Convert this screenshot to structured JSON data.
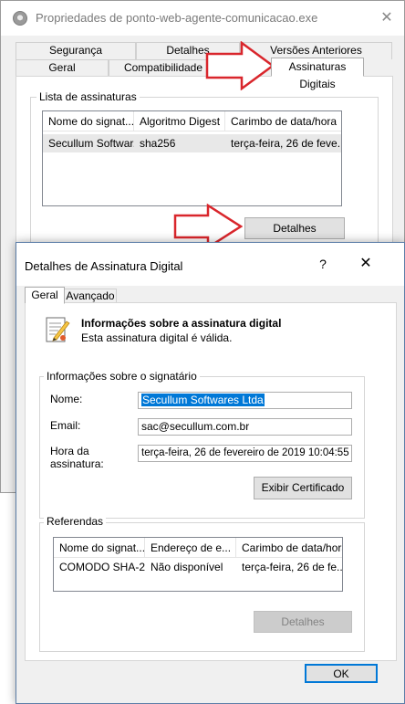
{
  "back_window": {
    "title": "Propriedades de ponto-web-agente-comunicacao.exe",
    "tabs_row1": [
      "Segurança",
      "Detalhes",
      "Versões Anteriores"
    ],
    "tabs_row2": [
      "Geral",
      "Compatibilidade",
      "Assinaturas Digitais"
    ],
    "group_label": "Lista de assinaturas",
    "list_headers": [
      "Nome do signat...",
      "Algoritmo Digest",
      "Carimbo de data/hora"
    ],
    "list_row": [
      "Secullum Softwar...",
      "sha256",
      "terça-feira, 26 de feve..."
    ],
    "details_button": "Detalhes"
  },
  "dialog": {
    "title": "Detalhes de Assinatura Digital",
    "help": "?",
    "tabs": [
      "Geral",
      "Avançado"
    ],
    "info_heading": "Informações sobre a assinatura digital",
    "info_status": "Esta assinatura digital é válida.",
    "signer_group_label": "Informações sobre o signatário",
    "name_label": "Nome:",
    "name_value": "Secullum Softwares Ltda",
    "email_label": "Email:",
    "email_value": "sac@secullum.com.br",
    "time_label_1": "Hora da",
    "time_label_2": "assinatura:",
    "time_value": "terça-feira, 26 de fevereiro de 2019 10:04:55",
    "view_cert_button": "Exibir Certificado",
    "refs_group_label": "Referendas",
    "refs_headers": [
      "Nome do signat...",
      "Endereço de e...",
      "Carimbo de data/hora"
    ],
    "refs_row": [
      "COMODO SHA-2...",
      "Não disponível",
      "terça-feira, 26 de fe..."
    ],
    "refs_details_button": "Detalhes",
    "ok_button": "OK"
  },
  "colors": {
    "selection": "#0078d7",
    "arrow": "#d9262c",
    "dialog_border": "#5c7ea8"
  },
  "icons": [
    "app-icon",
    "close-icon",
    "help-icon",
    "certificate-document-icon",
    "red-arrow-icon"
  ]
}
